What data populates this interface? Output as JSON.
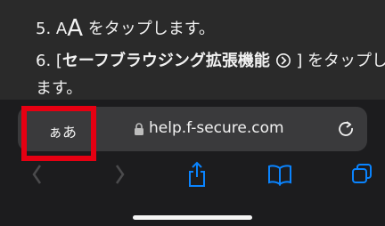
{
  "instructions": {
    "step5": {
      "number": "5.",
      "small_a": "A",
      "big_a": "A",
      "text": "をタップします。"
    },
    "step6": {
      "number": "6. [",
      "bold": "セーフブラウジング拡張機能",
      "tail": "] をタップし",
      "continuation": "ます。"
    }
  },
  "browser": {
    "aa_label": "ぁあ",
    "url": "help.f-secure.com",
    "icons": {
      "lock": "lock-icon",
      "reload": "reload-icon",
      "back": "chevron-left-icon",
      "forward": "chevron-right-icon",
      "share": "share-icon",
      "bookmarks": "book-icon",
      "tabs": "tabs-icon",
      "extension": "extension-icon"
    }
  },
  "colors": {
    "highlight": "#e60012",
    "accent": "#0a84ff",
    "background": "#1c1c1e"
  }
}
